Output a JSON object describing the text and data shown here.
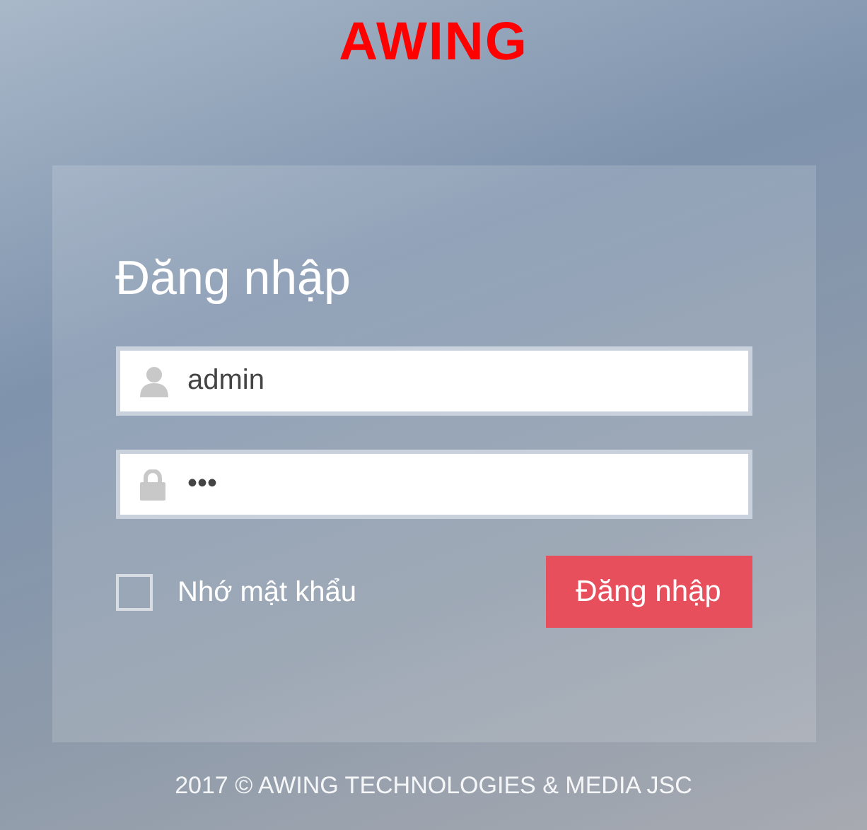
{
  "logo": {
    "text": "AWING"
  },
  "form": {
    "title": "Đăng nhập",
    "fields": [
      {
        "kind": "user",
        "value": "admin"
      },
      {
        "kind": "password",
        "value": "•••"
      }
    ],
    "remember": {
      "label": "Nhớ mật khẩu",
      "checked": false
    },
    "submit": "Đăng nhập"
  },
  "footer": "2017 © AWING TECHNOLOGIES & MEDIA JSC"
}
